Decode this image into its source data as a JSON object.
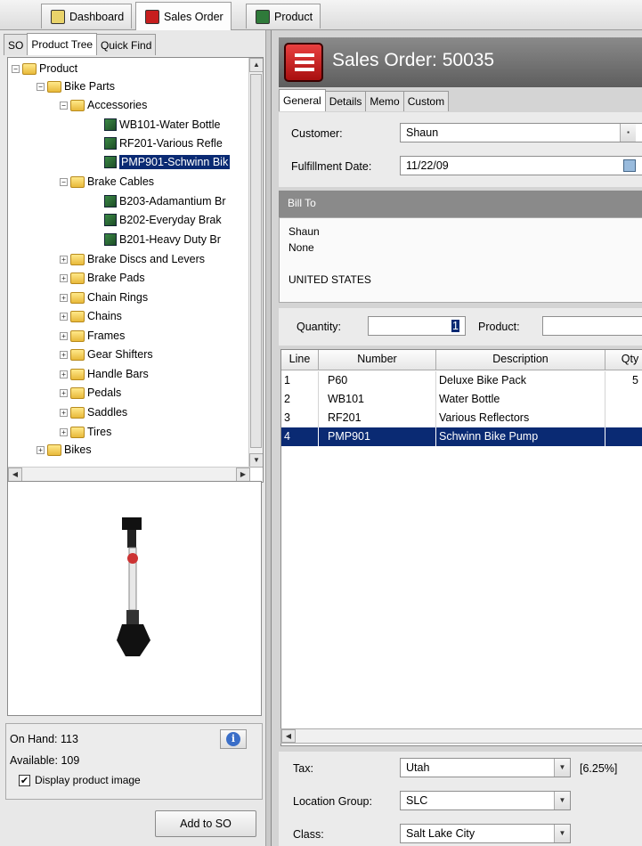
{
  "top_tabs": [
    {
      "label": "Dashboard"
    },
    {
      "label": "Sales Order"
    },
    {
      "label": "Product"
    }
  ],
  "left_tabs": [
    {
      "label": "SO"
    },
    {
      "label": "Product Tree"
    },
    {
      "label": "Quick Find"
    }
  ],
  "tree": {
    "root": "Product",
    "bike_parts": "Bike Parts",
    "accessories": "Accessories",
    "acc_items": [
      "WB101-Water Bottle",
      "RF201-Various Refle",
      "PMP901-Schwinn Bik"
    ],
    "brake_cables": "Brake Cables",
    "bc_items": [
      "B203-Adamantium Br",
      "B202-Everyday Brak",
      "B201-Heavy Duty Br"
    ],
    "folders": [
      "Brake Discs and Levers",
      "Brake Pads",
      "Chain Rings",
      "Chains",
      "Frames",
      "Gear Shifters",
      "Handle Bars",
      "Pedals",
      "Saddles",
      "Tires"
    ],
    "bikes": "Bikes"
  },
  "stock": {
    "on_hand": "On Hand: 113",
    "available": "Available: 109",
    "display_image": "Display product image"
  },
  "add_button": "Add to SO",
  "header": {
    "title": "Sales Order:  50035"
  },
  "right_tabs": [
    {
      "label": "General"
    },
    {
      "label": "Details"
    },
    {
      "label": "Memo"
    },
    {
      "label": "Custom"
    }
  ],
  "form": {
    "customer_label": "Customer:",
    "customer_value": "Shaun",
    "date_label": "Fulfillment Date:",
    "date_value": "11/22/09"
  },
  "bill_to": {
    "header": "Bill To",
    "lines": [
      "Shaun",
      "None",
      "",
      "UNITED STATES"
    ]
  },
  "qty_bar": {
    "quantity_label": "Quantity:",
    "quantity_value": "1",
    "product_label": "Product:"
  },
  "grid": {
    "headers": [
      "Line",
      "Number",
      "Description",
      "Qty"
    ],
    "rows": [
      {
        "line": "1",
        "number": "P60",
        "description": "Deluxe Bike Pack",
        "qty": "5"
      },
      {
        "line": "2",
        "number": "WB101",
        "description": "Water Bottle",
        "qty": ""
      },
      {
        "line": "3",
        "number": "RF201",
        "description": "Various Reflectors",
        "qty": ""
      },
      {
        "line": "4",
        "number": "PMP901",
        "description": "Schwinn Bike Pump",
        "qty": ""
      }
    ]
  },
  "bottom": {
    "tax_label": "Tax:",
    "tax_value": "Utah",
    "tax_rate": "[6.25%]",
    "location_label": "Location Group:",
    "location_value": "SLC",
    "class_label": "Class:",
    "class_value": "Salt Lake City"
  }
}
